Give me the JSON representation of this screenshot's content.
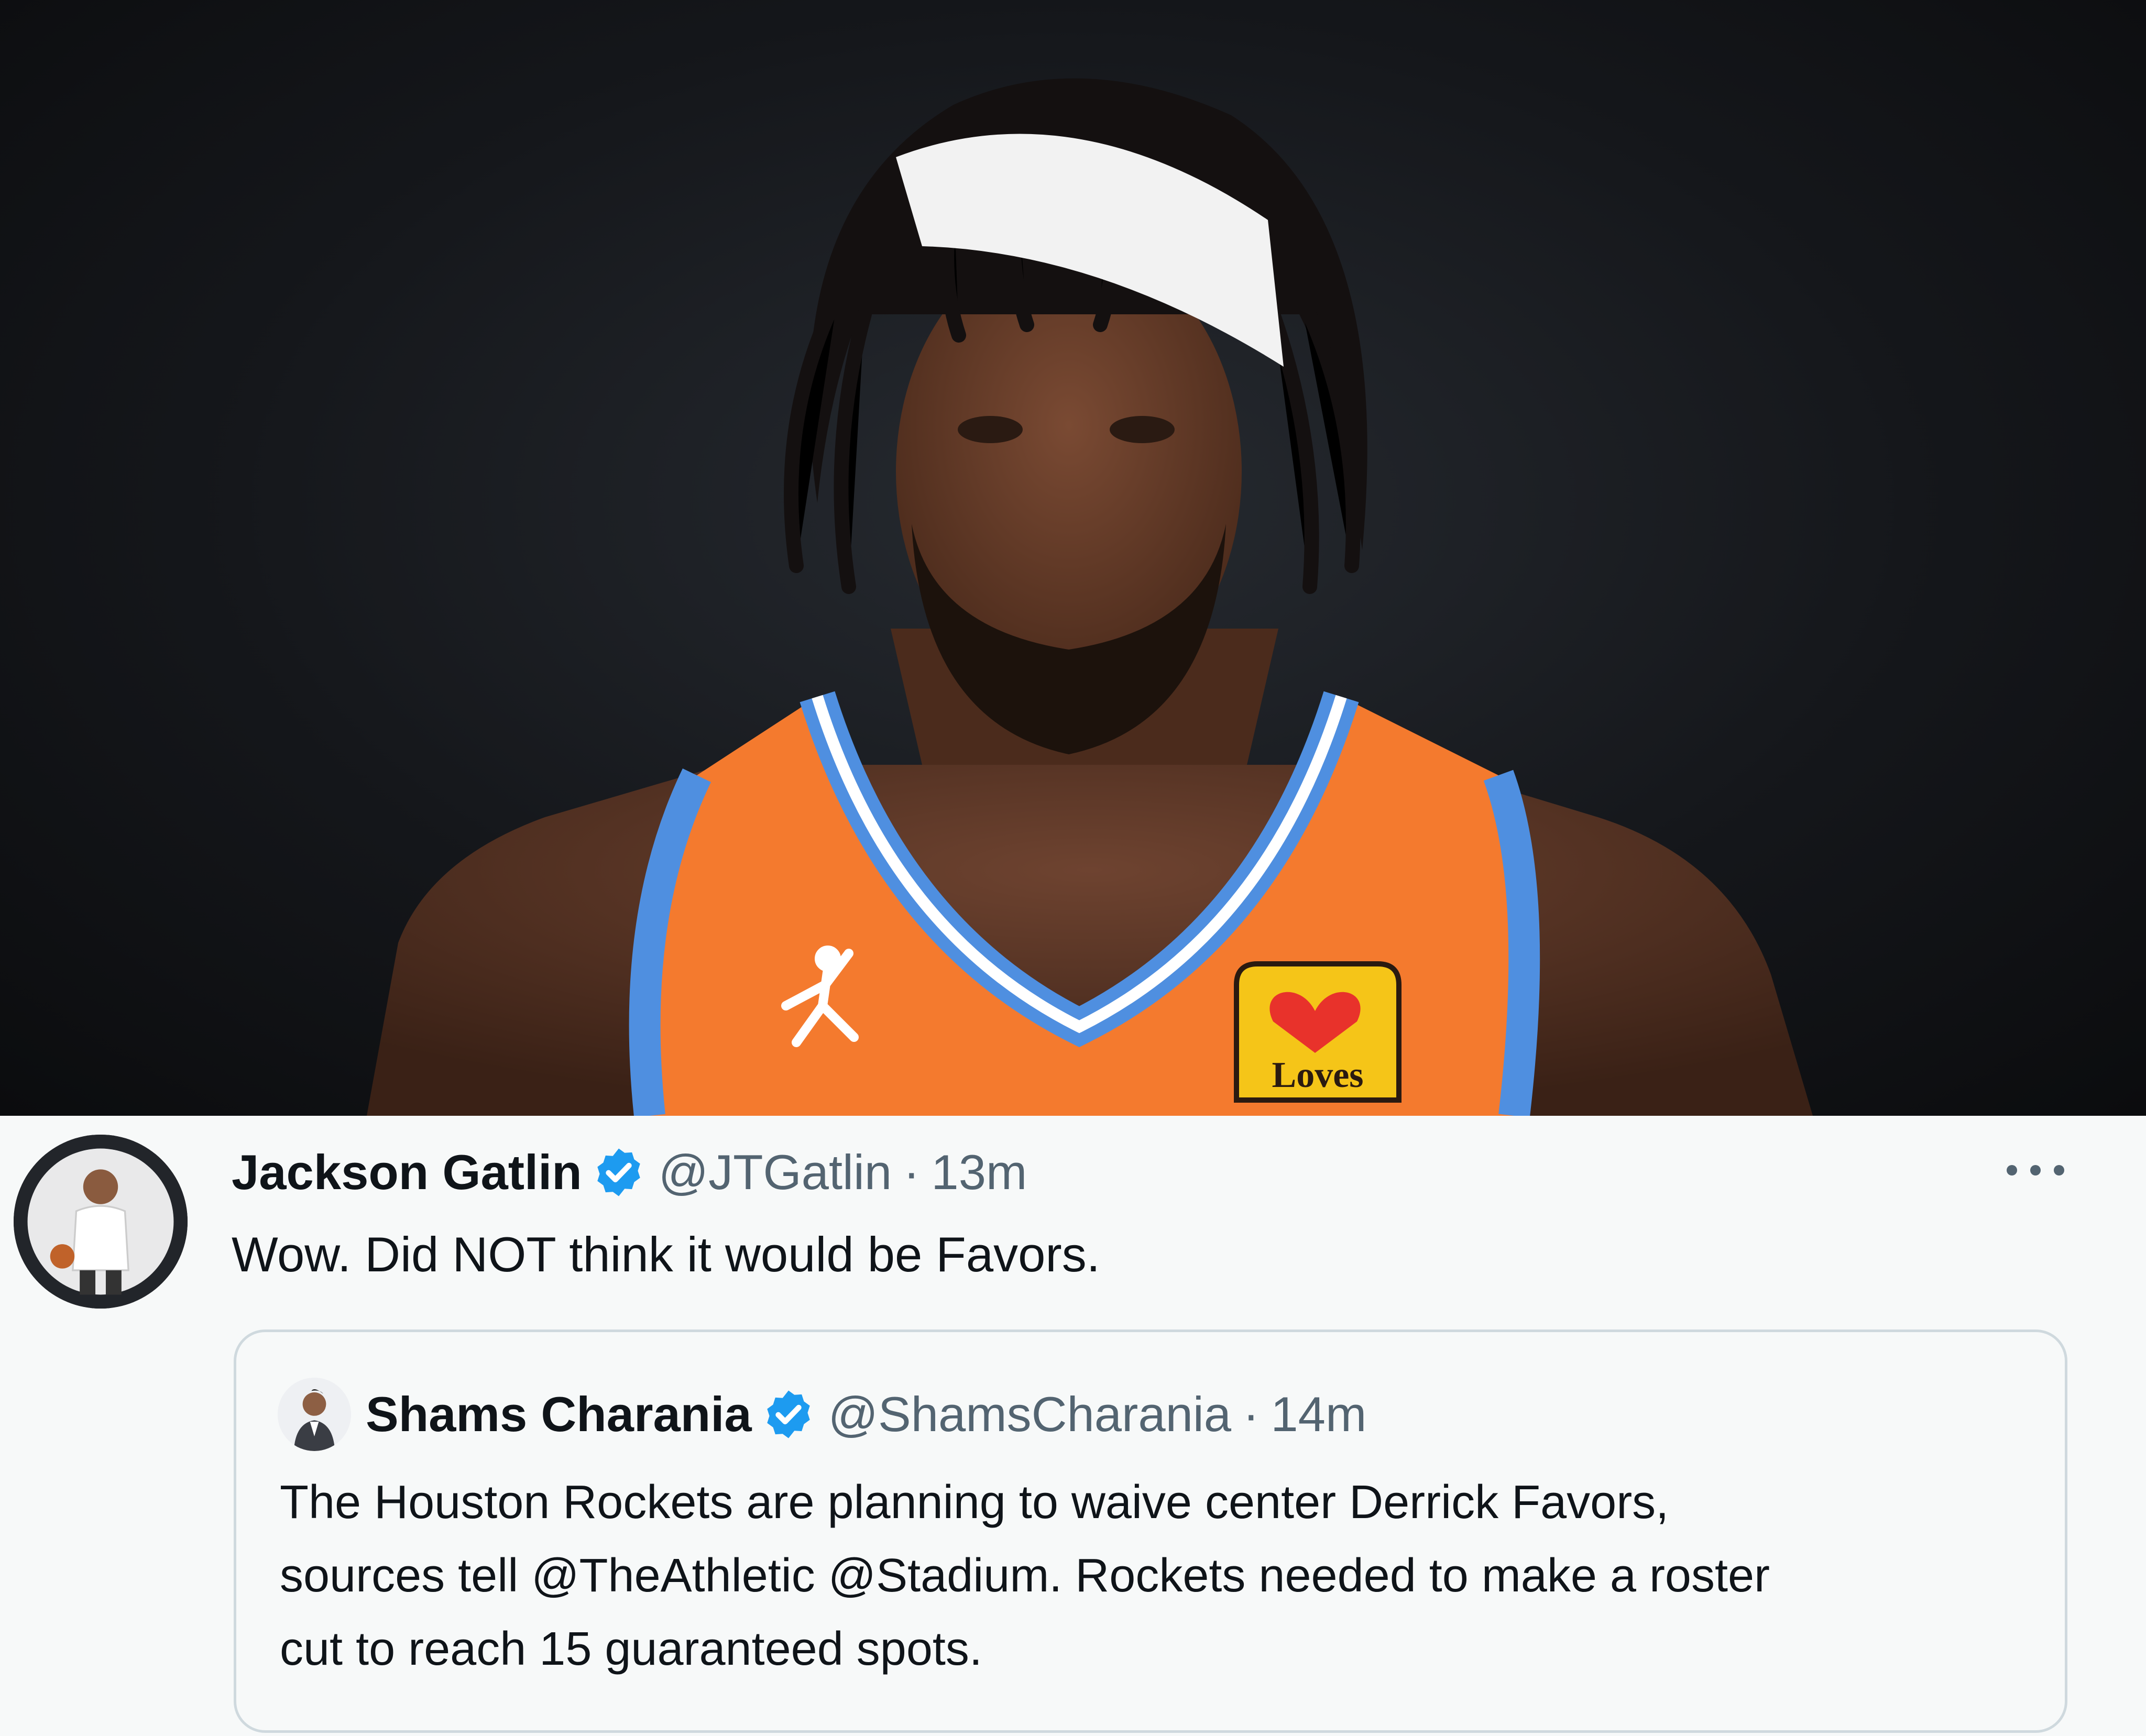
{
  "photo": {
    "sponsor_patch_text": "Loves",
    "jersey_color": "#f47a2e",
    "trim_color": "#4f8fe0"
  },
  "tweet": {
    "author_name": "Jackson Gatlin",
    "author_handle": "@JTGatlin",
    "separator": "·",
    "time": "13m",
    "text": "Wow. Did NOT think it would be Favors.",
    "more_icon": "more-icon"
  },
  "quoted_tweet": {
    "author_name": "Shams Charania",
    "author_handle": "@ShamsCharania",
    "separator": "·",
    "time": "14m",
    "text_lines": [
      "The Houston Rockets are planning to waive center Derrick Favors,",
      "sources tell @TheAthletic @Stadium. Rockets needed to make a roster",
      "cut to reach 15 guaranteed spots."
    ]
  },
  "colors": {
    "verified_blue": "#1d9bf0",
    "secondary_text": "#536471",
    "primary_text": "#0f1419",
    "border": "#cfd9de"
  }
}
